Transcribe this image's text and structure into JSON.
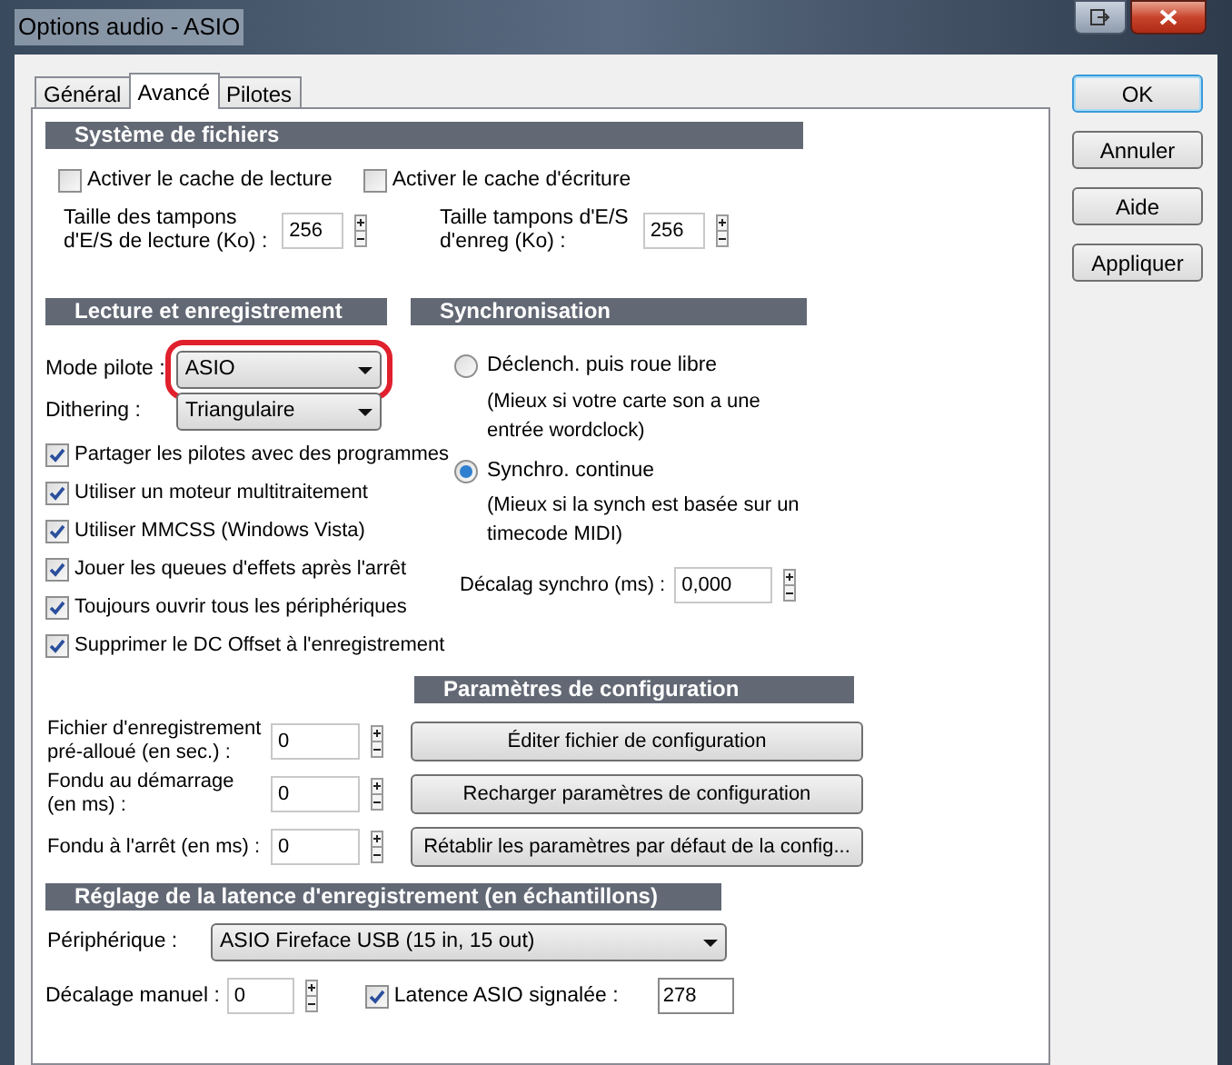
{
  "window": {
    "title": "Options audio - ASIO"
  },
  "tabs": [
    {
      "label": "Général",
      "selected": false
    },
    {
      "label": "Avancé",
      "selected": true
    },
    {
      "label": "Pilotes",
      "selected": false
    }
  ],
  "action_buttons": [
    {
      "label": "OK",
      "default": true
    },
    {
      "label": "Annuler",
      "default": false
    },
    {
      "label": "Aide",
      "default": false
    },
    {
      "label": "Appliquer",
      "default": false
    }
  ],
  "file_system": {
    "title": "Système de fichiers",
    "checkboxes": [
      {
        "label": "Activer le cache de lecture",
        "checked": false
      },
      {
        "label": "Activer le cache d'écriture",
        "checked": false
      }
    ],
    "buffers": [
      {
        "label": "Taille des tampons\nd'E/S de lecture (Ko) :",
        "value": "256"
      },
      {
        "label": "Taille tampons d'E/S\nd'enreg (Ko) :",
        "value": "256"
      }
    ]
  },
  "playback": {
    "title": "Lecture et enregistrement",
    "driver_mode": {
      "label": "Mode pilote :",
      "value": "ASIO",
      "circled": true
    },
    "dithering": {
      "label": "Dithering :",
      "value": "Triangulaire"
    },
    "options": [
      {
        "label": "Partager les pilotes avec des programmes",
        "checked": true
      },
      {
        "label": "Utiliser un moteur multitraitement",
        "checked": true
      },
      {
        "label": "Utiliser MMCSS (Windows Vista)",
        "checked": true
      },
      {
        "label": "Jouer les queues d'effets après l'arrêt",
        "checked": true
      },
      {
        "label": "Toujours ouvrir tous les périphériques",
        "checked": true
      },
      {
        "label": "Supprimer le DC Offset à l'enregistrement",
        "checked": true
      }
    ]
  },
  "sync": {
    "title": "Synchronisation",
    "modes": [
      {
        "label": "Déclench. puis roue libre",
        "note": "(Mieux si votre carte son a une entrée wordclock)",
        "selected": false
      },
      {
        "label": "Synchro. continue",
        "note": "(Mieux si la synch est basée sur un timecode MIDI)",
        "selected": true
      }
    ],
    "offset": {
      "label": "Décalag synchro (ms) :",
      "value": "0,000"
    }
  },
  "config": {
    "title": "Paramètres de configuration",
    "fields": [
      {
        "label": "Fichier d'enregistrement\npré-alloué (en sec.) :",
        "value": "0"
      },
      {
        "label": "Fondu au démarrage\n(en ms) :",
        "value": "0"
      },
      {
        "label": "Fondu à l'arrêt  (en ms) :",
        "value": "0"
      }
    ],
    "buttons": [
      "Éditer fichier de configuration",
      "Recharger paramètres de configuration",
      "Rétablir les paramètres par défaut de la config..."
    ]
  },
  "latency": {
    "title": "Réglage de la latence d'enregistrement (en échantillons)",
    "device": {
      "label": "Périphérique :",
      "value": "ASIO Fireface USB (15 in, 15 out)"
    },
    "manual_offset": {
      "label": "Décalage manuel :",
      "value": "0"
    },
    "reported": {
      "label": "Latence ASIO signalée :",
      "checked": true,
      "value": "278"
    }
  }
}
